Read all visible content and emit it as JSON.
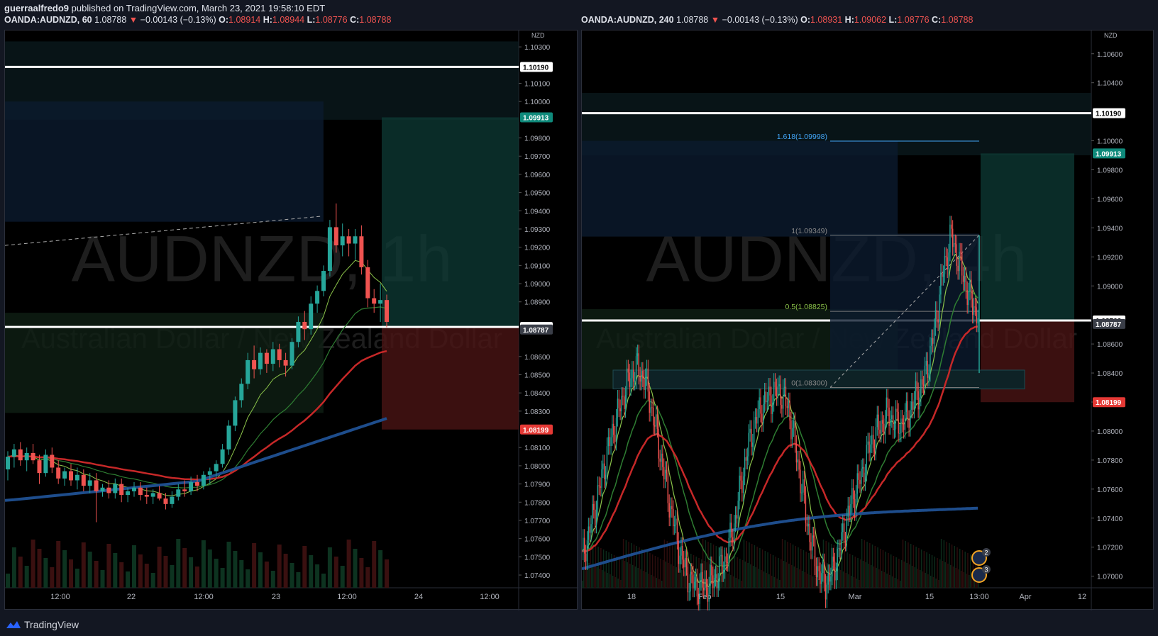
{
  "header": {
    "user": "guerraalfredo9",
    "published_text": "published on TradingView.com, March 23, 2021 19:58:10 EDT"
  },
  "footer": {
    "brand": "TradingView",
    "logo_icon": "tradingview-logo-icon"
  },
  "charts": [
    {
      "symbol": "OANDA:AUDNZD, 60",
      "price": "1.08788",
      "change": "−0.00143 (−0.13%)",
      "o": "1.08914",
      "h": "1.08944",
      "l": "1.08776",
      "c": "1.08788",
      "currency": "NZD",
      "watermark": "AUDNZD, 1h",
      "watermark_sub": "Australian Dollar / New Zealand Dollar"
    },
    {
      "symbol": "OANDA:AUDNZD, 240",
      "price": "1.08788",
      "change": "−0.00143 (−0.13%)",
      "o": "1.08931",
      "h": "1.09062",
      "l": "1.08776",
      "c": "1.08788",
      "currency": "NZD",
      "watermark": "AUDNZD, 4h",
      "watermark_sub": "Australian Dollar / New Zealand Dollar"
    }
  ],
  "colors": {
    "up": "#26a69a",
    "down": "#ef5350",
    "background": "#000000",
    "ema_fast": "#8bc34a",
    "ema_mid": "#2e7d32",
    "ema_slow": "#c62828",
    "ema_long": "#1e4d8c",
    "white_line": "#ffffff",
    "fib": "#42a5f5"
  },
  "chart_data": [
    {
      "type": "candlestick",
      "title": "OANDA:AUDNZD, 60",
      "ylim": [
        1.0733,
        1.1039
      ],
      "y_ticks": [
        "1.10300",
        "1.10100",
        "1.10000",
        "1.09800",
        "1.09700",
        "1.09600",
        "1.09500",
        "1.09400",
        "1.09300",
        "1.09200",
        "1.09100",
        "1.09000",
        "1.08900",
        "1.08600",
        "1.08500",
        "1.08400",
        "1.08300",
        "1.08100",
        "1.08000",
        "1.07900",
        "1.07800",
        "1.07700",
        "1.07600",
        "1.07500",
        "1.07400"
      ],
      "x_ticks": [
        "12:00",
        "22",
        "12:00",
        "23",
        "12:00",
        "24",
        "12:00"
      ],
      "price_labels": [
        {
          "value": 1.1019,
          "text": "1.10190",
          "style": "white"
        },
        {
          "value": 1.09913,
          "text": "1.09913",
          "style": "green"
        },
        {
          "value": 1.08762,
          "text": "1.08762",
          "style": "white"
        },
        {
          "value": 1.08787,
          "text": "1.08787",
          "style": "grey"
        },
        {
          "value": 1.08199,
          "text": "1.08199",
          "style": "red"
        }
      ],
      "horizontal_lines": [
        1.1019,
        1.08762
      ],
      "position_tool": {
        "entry": 1.08762,
        "target": 1.09913,
        "stop": 1.08199
      },
      "candles": [
        [
          1.0798,
          1.0808,
          1.0792,
          1.0805
        ],
        [
          1.0805,
          1.0812,
          1.0799,
          1.0809
        ],
        [
          1.0809,
          1.0813,
          1.08,
          1.0803
        ],
        [
          1.0803,
          1.081,
          1.0797,
          1.0807
        ],
        [
          1.0807,
          1.0812,
          1.0801,
          1.0803
        ],
        [
          1.0803,
          1.0806,
          1.079,
          1.0796
        ],
        [
          1.0796,
          1.0809,
          1.0794,
          1.0806
        ],
        [
          1.0806,
          1.081,
          1.0796,
          1.0799
        ],
        [
          1.0799,
          1.0803,
          1.079,
          1.0793
        ],
        [
          1.0793,
          1.0799,
          1.0789,
          1.0797
        ],
        [
          1.0797,
          1.0801,
          1.0789,
          1.0792
        ],
        [
          1.0792,
          1.0799,
          1.0787,
          1.0795
        ],
        [
          1.0795,
          1.0798,
          1.0786,
          1.0789
        ],
        [
          1.0789,
          1.0796,
          1.0785,
          1.0792
        ],
        [
          1.0792,
          1.0796,
          1.0769,
          1.0786
        ],
        [
          1.0786,
          1.079,
          1.0783,
          1.0788
        ],
        [
          1.0788,
          1.0792,
          1.0782,
          1.0785
        ],
        [
          1.0785,
          1.0793,
          1.0782,
          1.079
        ],
        [
          1.079,
          1.0793,
          1.078,
          1.0784
        ],
        [
          1.0784,
          1.0788,
          1.078,
          1.0786
        ],
        [
          1.0786,
          1.0791,
          1.0783,
          1.0788
        ],
        [
          1.0788,
          1.0791,
          1.0781,
          1.0784
        ],
        [
          1.0784,
          1.0788,
          1.0779,
          1.0783
        ],
        [
          1.0783,
          1.0787,
          1.0779,
          1.0785
        ],
        [
          1.0785,
          1.0789,
          1.0781,
          1.0782
        ],
        [
          1.0782,
          1.0785,
          1.0776,
          1.0779
        ],
        [
          1.0779,
          1.0786,
          1.0777,
          1.0783
        ],
        [
          1.0783,
          1.079,
          1.0781,
          1.0787
        ],
        [
          1.0787,
          1.0792,
          1.0783,
          1.0786
        ],
        [
          1.0786,
          1.0794,
          1.0784,
          1.0791
        ],
        [
          1.0791,
          1.0795,
          1.0786,
          1.0789
        ],
        [
          1.0789,
          1.0797,
          1.0787,
          1.0795
        ],
        [
          1.0795,
          1.0799,
          1.079,
          1.0797
        ],
        [
          1.0797,
          1.0803,
          1.0793,
          1.0801
        ],
        [
          1.0801,
          1.0812,
          1.0799,
          1.0809
        ],
        [
          1.0809,
          1.0825,
          1.0806,
          1.0822
        ],
        [
          1.0822,
          1.0838,
          1.0819,
          1.0836
        ],
        [
          1.0836,
          1.0848,
          1.0832,
          1.0845
        ],
        [
          1.0845,
          1.0862,
          1.0842,
          1.0858
        ],
        [
          1.0858,
          1.0866,
          1.0848,
          1.0853
        ],
        [
          1.0853,
          1.0865,
          1.085,
          1.0862
        ],
        [
          1.0862,
          1.0864,
          1.0851,
          1.0856
        ],
        [
          1.0856,
          1.0868,
          1.0852,
          1.0864
        ],
        [
          1.0864,
          1.0867,
          1.0854,
          1.0858
        ],
        [
          1.0858,
          1.0862,
          1.0849,
          1.0855
        ],
        [
          1.0855,
          1.087,
          1.0853,
          1.0868
        ],
        [
          1.0868,
          1.0882,
          1.0865,
          1.0879
        ],
        [
          1.0879,
          1.0885,
          1.0869,
          1.0875
        ],
        [
          1.0875,
          1.0893,
          1.0872,
          1.0889
        ],
        [
          1.0889,
          1.0899,
          1.0884,
          1.0896
        ],
        [
          1.0896,
          1.091,
          1.0893,
          1.0907
        ],
        [
          1.0907,
          1.0935,
          1.0904,
          1.0931
        ],
        [
          1.0931,
          1.0944,
          1.0917,
          1.0921
        ],
        [
          1.0921,
          1.0933,
          1.0915,
          1.0926
        ],
        [
          1.0926,
          1.093,
          1.0915,
          1.0922
        ],
        [
          1.0922,
          1.093,
          1.0913,
          1.0926
        ],
        [
          1.0926,
          1.0932,
          1.0905,
          1.0909
        ],
        [
          1.0909,
          1.0913,
          1.0887,
          1.0892
        ],
        [
          1.0892,
          1.0897,
          1.0884,
          1.0889
        ],
        [
          1.0889,
          1.09,
          1.0879,
          1.0891
        ],
        [
          1.0891,
          1.0894,
          1.0876,
          1.0879
        ]
      ]
    },
    {
      "type": "candlestick",
      "title": "OANDA:AUDNZD, 240",
      "ylim": [
        1.0692,
        1.1076
      ],
      "y_ticks": [
        "1.10600",
        "1.10400",
        "1.10000",
        "1.09800",
        "1.09600",
        "1.09400",
        "1.09200",
        "1.09000",
        "1.08600",
        "1.08400",
        "1.08200",
        "1.08000",
        "1.07800",
        "1.07600",
        "1.07400",
        "1.07200",
        "1.07000"
      ],
      "x_ticks": [
        "18",
        "Feb",
        "15",
        "Mar",
        "15",
        "13:00",
        "Apr",
        "12"
      ],
      "price_labels": [
        {
          "value": 1.1019,
          "text": "1.10190",
          "style": "white"
        },
        {
          "value": 1.09913,
          "text": "1.09913",
          "style": "green"
        },
        {
          "value": 1.08762,
          "text": "1.08762",
          "style": "white"
        },
        {
          "value": 1.08787,
          "text": "1.08787",
          "style": "grey"
        },
        {
          "value": 1.08199,
          "text": "1.08199",
          "style": "red"
        }
      ],
      "horizontal_lines": [
        1.1019,
        1.08762
      ],
      "position_tool": {
        "entry": 1.08762,
        "target": 1.09913,
        "stop": 1.08199
      },
      "fib_levels": [
        {
          "label": "1.618(1.09998)",
          "value": 1.09998
        },
        {
          "label": "1(1.09349)",
          "value": 1.09349
        },
        {
          "label": "0.5(1.08825)",
          "value": 1.08825
        },
        {
          "label": "0(1.08300)",
          "value": 1.083
        }
      ],
      "event_badges": [
        "2",
        "3"
      ],
      "price_path": [
        1.0712,
        1.0735,
        1.0762,
        1.079,
        1.0812,
        1.0832,
        1.0844,
        1.0836,
        1.0808,
        1.0775,
        1.0742,
        1.0714,
        1.0696,
        1.0692,
        1.0694,
        1.07,
        1.0712,
        1.0738,
        1.0775,
        1.0802,
        1.0818,
        1.0824,
        1.0828,
        1.0815,
        1.0778,
        1.0738,
        1.0708,
        1.0694,
        1.0705,
        1.0728,
        1.0752,
        1.0768,
        1.079,
        1.0802,
        1.0812,
        1.0804,
        1.0808,
        1.0822,
        1.0834,
        1.0863,
        1.0905,
        1.0935,
        1.0915,
        1.0893,
        1.088
      ]
    }
  ]
}
